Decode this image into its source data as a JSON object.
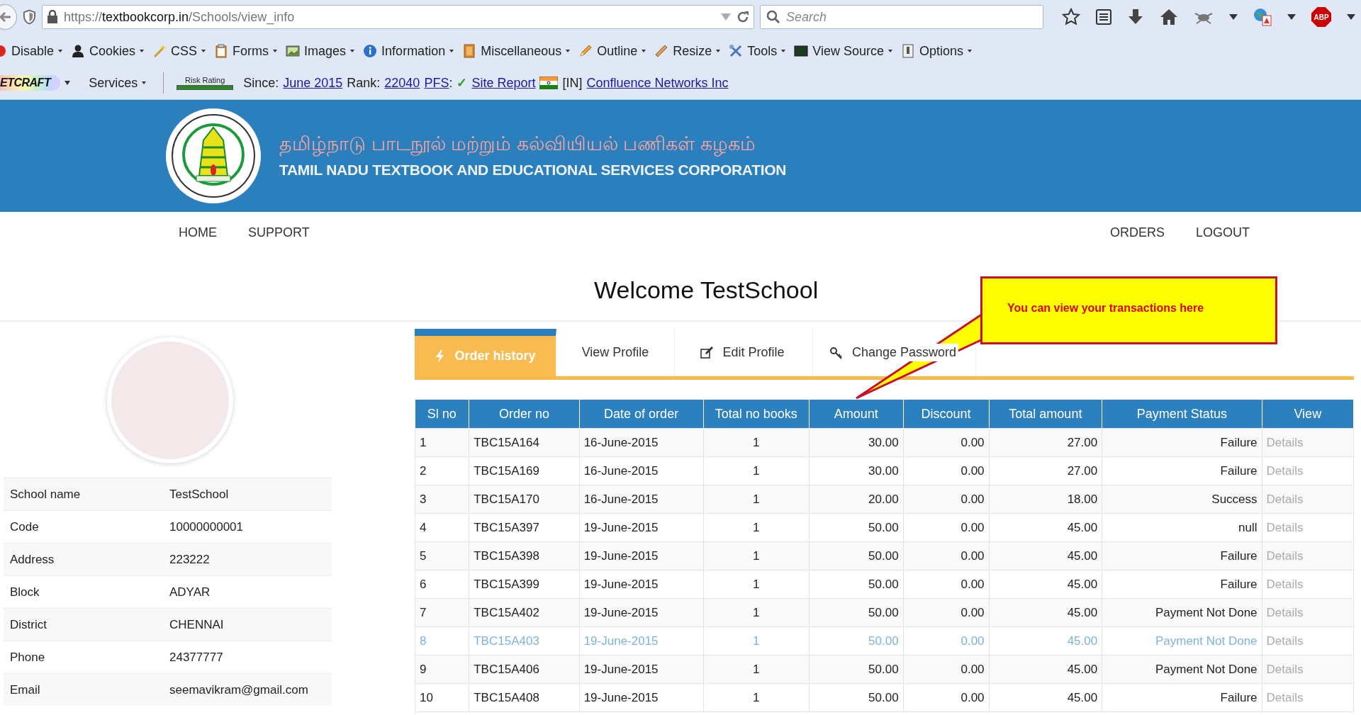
{
  "browser": {
    "url": {
      "scheme": "https://",
      "host": "textbookcorp.in",
      "path": "/Schools/view_info"
    },
    "search_placeholder": "Search",
    "abp_label": "ABP"
  },
  "devbar": [
    {
      "label": "Disable"
    },
    {
      "label": "Cookies"
    },
    {
      "label": "CSS"
    },
    {
      "label": "Forms"
    },
    {
      "label": "Images"
    },
    {
      "label": "Information"
    },
    {
      "label": "Miscellaneous"
    },
    {
      "label": "Outline"
    },
    {
      "label": "Resize"
    },
    {
      "label": "Tools"
    },
    {
      "label": "View Source"
    },
    {
      "label": "Options"
    }
  ],
  "netcraft": {
    "logo": "ETCRAFT",
    "services": "Services",
    "risk_label": "Risk Rating",
    "parts": [
      {
        "kind": "text",
        "text": "Since:"
      },
      {
        "kind": "link",
        "text": "June 2015"
      },
      {
        "kind": "text",
        "text": "Rank:"
      },
      {
        "kind": "link",
        "text": "22040"
      },
      {
        "kind": "link",
        "text": "PFS"
      },
      {
        "kind": "punct",
        "text": ":"
      },
      {
        "kind": "check",
        "text": "✓"
      },
      {
        "kind": "link",
        "text": "Site Report"
      },
      {
        "kind": "flag"
      },
      {
        "kind": "text",
        "text": "[IN]"
      },
      {
        "kind": "link",
        "text": "Confluence Networks Inc"
      }
    ]
  },
  "header": {
    "tamil_title": "தமிழ்நாடு பாடநூல் மற்றும் கல்வியியல் பணிகள் கழகம்",
    "english_title": "TAMIL NADU TEXTBOOK AND EDUCATIONAL SERVICES CORPORATION"
  },
  "nav": {
    "left": [
      "HOME",
      "SUPPORT"
    ],
    "right": [
      "ORDERS",
      "LOGOUT"
    ]
  },
  "welcome": "Welcome TestSchool",
  "profile": [
    {
      "label": "School name",
      "value": "TestSchool"
    },
    {
      "label": "Code",
      "value": "10000000001"
    },
    {
      "label": "Address",
      "value": "223222"
    },
    {
      "label": "Block",
      "value": "ADYAR"
    },
    {
      "label": "District",
      "value": "CHENNAI"
    },
    {
      "label": "Phone",
      "value": "24377777"
    },
    {
      "label": "Email",
      "value": "seemavikram@gmail.com"
    }
  ],
  "tabs": [
    {
      "label": "Order history",
      "selected": true
    },
    {
      "label": "View Profile",
      "selected": false
    },
    {
      "label": "Edit Profile",
      "selected": false
    },
    {
      "label": "Change Password",
      "selected": false
    }
  ],
  "table": {
    "columns": [
      "Sl no",
      "Order no",
      "Date of order",
      "Total no books",
      "Amount",
      "Discount",
      "Total amount",
      "Payment Status",
      "View"
    ],
    "rows": [
      {
        "cells": [
          "1",
          "TBC15A164",
          "16-June-2015",
          "1",
          "30.00",
          "0.00",
          "27.00",
          "Failure"
        ],
        "link": "Details",
        "highlighted": false
      },
      {
        "cells": [
          "2",
          "TBC15A169",
          "16-June-2015",
          "1",
          "30.00",
          "0.00",
          "27.00",
          "Failure"
        ],
        "link": "Details",
        "highlighted": false
      },
      {
        "cells": [
          "3",
          "TBC15A170",
          "16-June-2015",
          "1",
          "20.00",
          "0.00",
          "18.00",
          "Success"
        ],
        "link": "Details",
        "highlighted": false
      },
      {
        "cells": [
          "4",
          "TBC15A397",
          "19-June-2015",
          "1",
          "50.00",
          "0.00",
          "45.00",
          "null"
        ],
        "link": "Details",
        "highlighted": false
      },
      {
        "cells": [
          "5",
          "TBC15A398",
          "19-June-2015",
          "1",
          "50.00",
          "0.00",
          "45.00",
          "Failure"
        ],
        "link": "Details",
        "highlighted": false
      },
      {
        "cells": [
          "6",
          "TBC15A399",
          "19-June-2015",
          "1",
          "50.00",
          "0.00",
          "45.00",
          "Failure"
        ],
        "link": "Details",
        "highlighted": false
      },
      {
        "cells": [
          "7",
          "TBC15A402",
          "19-June-2015",
          "1",
          "50.00",
          "0.00",
          "45.00",
          "Payment Not Done"
        ],
        "link": "Details",
        "highlighted": false
      },
      {
        "cells": [
          "8",
          "TBC15A403",
          "19-June-2015",
          "1",
          "50.00",
          "0.00",
          "45.00",
          "Payment Not Done"
        ],
        "link": "Details",
        "highlighted": true
      },
      {
        "cells": [
          "9",
          "TBC15A406",
          "19-June-2015",
          "1",
          "50.00",
          "0.00",
          "45.00",
          "Payment Not Done"
        ],
        "link": "Details",
        "highlighted": false
      },
      {
        "cells": [
          "10",
          "TBC15A408",
          "19-June-2015",
          "1",
          "50.00",
          "0.00",
          "45.00",
          "Failure"
        ],
        "link": "Details",
        "highlighted": false
      }
    ]
  },
  "callout": "You can view your transactions here"
}
